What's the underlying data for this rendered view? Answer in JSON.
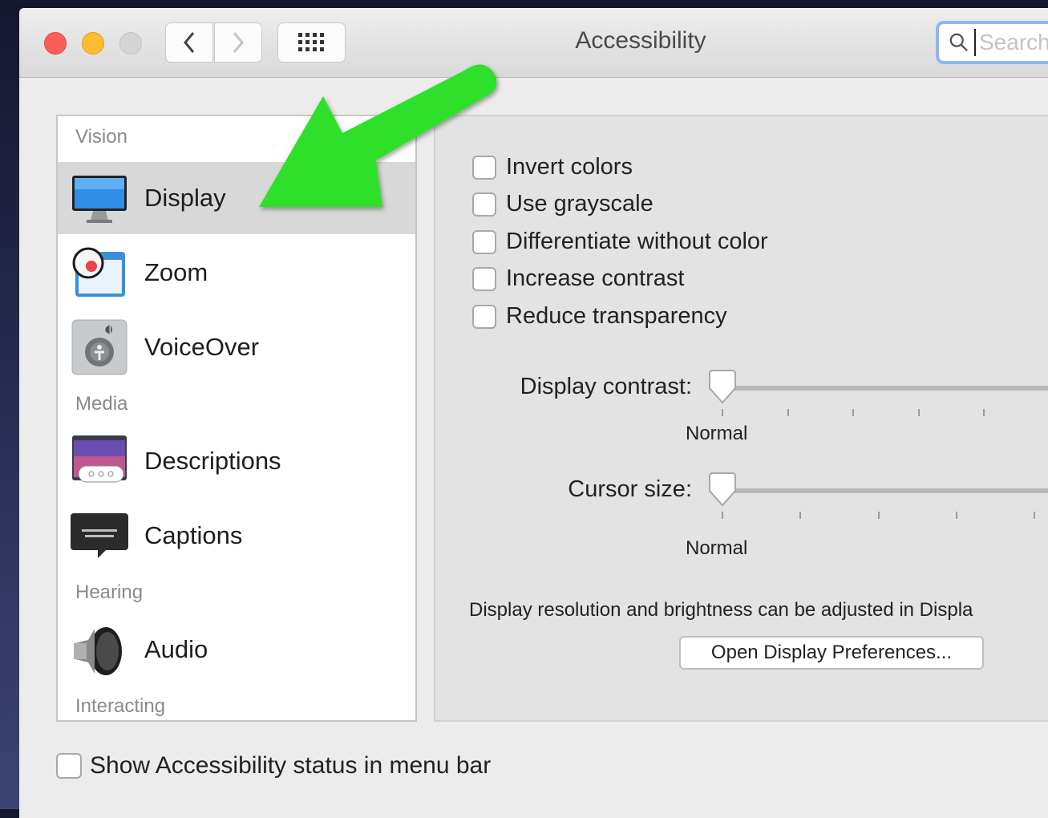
{
  "window": {
    "title": "Accessibility"
  },
  "toolbar": {
    "back_icon": "chevron-left",
    "forward_icon": "chevron-right",
    "grid_icon": "show-all-grid"
  },
  "search": {
    "placeholder": "Search"
  },
  "sidebar": {
    "sections": {
      "vision": "Vision",
      "media": "Media",
      "hearing": "Hearing",
      "interacting": "Interacting"
    },
    "items": [
      {
        "label": "Display",
        "icon": "display-monitor-icon",
        "selected": true
      },
      {
        "label": "Zoom",
        "icon": "zoom-magnifier-icon"
      },
      {
        "label": "VoiceOver",
        "icon": "voiceover-speaker-icon"
      },
      {
        "label": "Descriptions",
        "icon": "descriptions-icon"
      },
      {
        "label": "Captions",
        "icon": "captions-icon"
      },
      {
        "label": "Audio",
        "icon": "audio-speaker-icon"
      }
    ]
  },
  "display_panel": {
    "checkboxes": [
      {
        "label": "Invert colors",
        "checked": false
      },
      {
        "label": "Use grayscale",
        "checked": false
      },
      {
        "label": "Differentiate without color",
        "checked": false
      },
      {
        "label": "Increase contrast",
        "checked": false
      },
      {
        "label": "Reduce transparency",
        "checked": false
      }
    ],
    "display_contrast": {
      "label": "Display contrast:",
      "value_label": "Normal",
      "value": 0
    },
    "cursor_size": {
      "label": "Cursor size:",
      "value_label": "Normal",
      "value": 0
    },
    "note": "Display resolution and brightness can be adjusted in Displa",
    "open_prefs_button": "Open Display Preferences..."
  },
  "footer": {
    "show_status_label": "Show Accessibility status in menu bar",
    "checked": false
  },
  "colors": {
    "annotation_arrow": "#2fe02a",
    "search_focus": "#8cb6f3",
    "selected_row": "#d8d8d8"
  }
}
